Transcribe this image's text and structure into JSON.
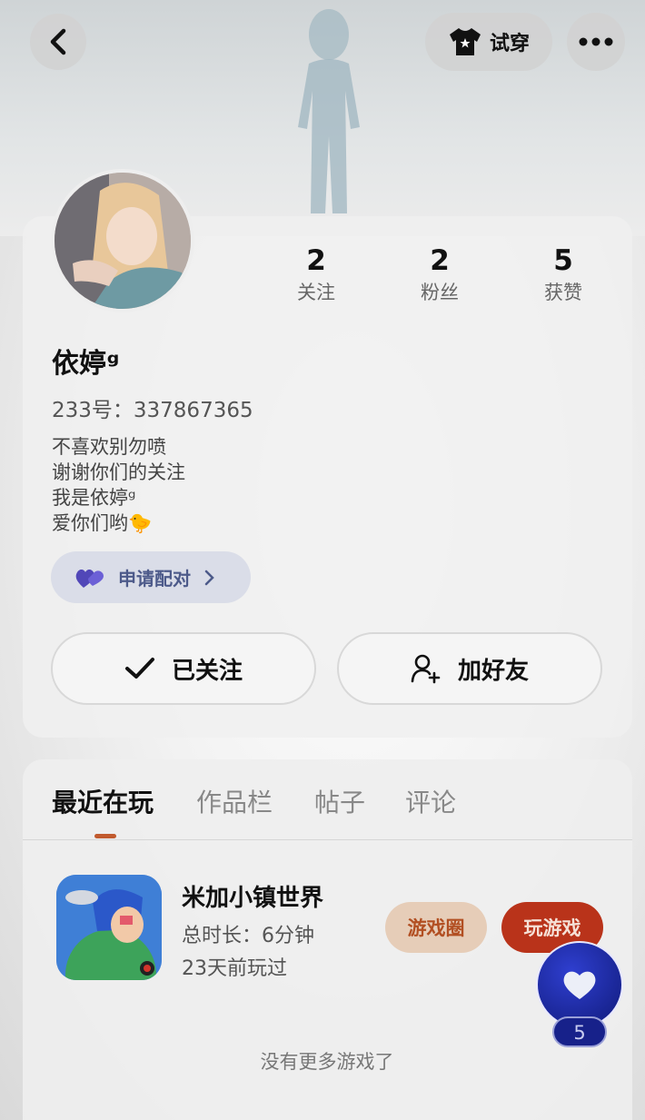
{
  "header": {
    "try_on_label": "试穿"
  },
  "profile": {
    "nickname": "依婷ᵍ",
    "uid_text": "233号：337867365",
    "bio": [
      "不喜欢别勿喷",
      "谢谢你们的关注",
      "我是依婷ᵍ",
      "爱你们哟🐤"
    ],
    "stats": [
      {
        "value": "2",
        "label": "关注"
      },
      {
        "value": "2",
        "label": "粉丝"
      },
      {
        "value": "5",
        "label": "获赞"
      }
    ],
    "pair_label": "申请配对",
    "follow_label": "已关注",
    "add_friend_label": "加好友"
  },
  "tabs": [
    {
      "label": "最近在玩",
      "active": true
    },
    {
      "label": "作品栏",
      "active": false
    },
    {
      "label": "帖子",
      "active": false
    },
    {
      "label": "评论",
      "active": false
    }
  ],
  "game": {
    "name": "米加小镇世界",
    "duration": "总时长：6分钟",
    "last_played": "23天前玩过",
    "circle_label": "游戏圈",
    "play_label": "玩游戏"
  },
  "like": {
    "count": "5"
  },
  "footer_text": "没有更多游戏了",
  "colors": {
    "accent": "#c15a2e",
    "play_button": "#b9331a",
    "like_fab": "#1a2596",
    "pair_text": "#4d5a8a"
  }
}
